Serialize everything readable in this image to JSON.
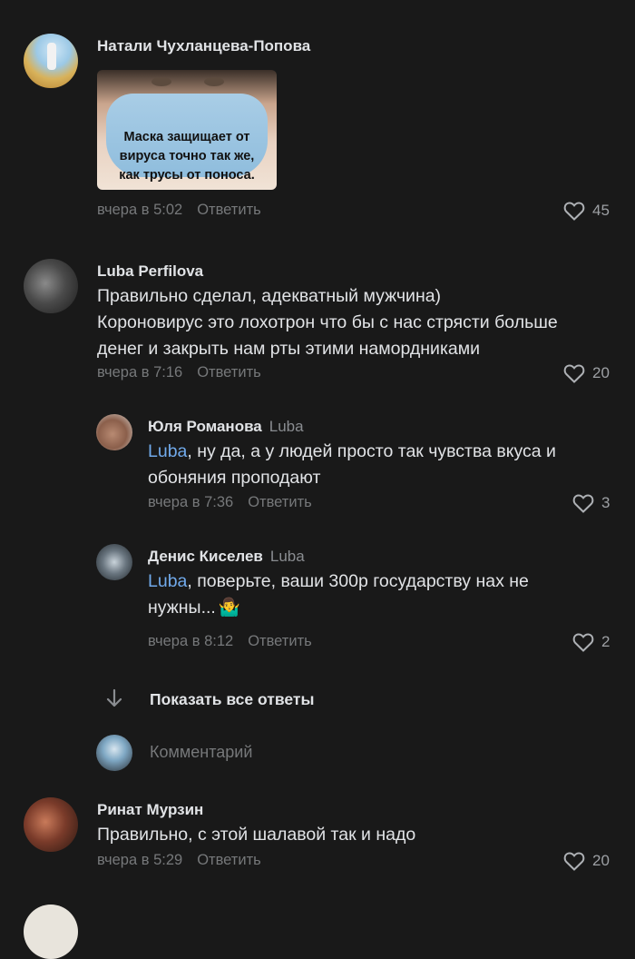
{
  "comments": [
    {
      "author": "Натали Чухланцева-Попова",
      "image_caption": [
        "Маска защищает от",
        "вируса точно так же,",
        "как трусы от поноса."
      ],
      "time": "вчера в 5:02",
      "reply_label": "Ответить",
      "likes": "45"
    },
    {
      "author": "Luba Perfilova",
      "text_lines": [
        "Правильно сделал, адекватный мужчина)",
        "Короновирус это лохотрон что бы с нас стрясти больше",
        "денег и закрыть нам рты этими намордниками"
      ],
      "time": "вчера в 7:16",
      "reply_label": "Ответить",
      "likes": "20",
      "replies": [
        {
          "author": "Юля Романова",
          "reply_to": "Luba",
          "mention": "Luba",
          "text_line1": ", ну да, а у людей просто так чувства вкуса и",
          "text_line2": "обоняния проподают",
          "time": "вчера в 7:36",
          "reply_label": "Ответить",
          "likes": "3"
        },
        {
          "author": "Денис Киселев",
          "reply_to": "Luba",
          "mention": "Luba",
          "text_line1": ", поверьте, ваши 300р государству нах не",
          "text_line2": "нужны...",
          "emoji": "🤷‍♂️",
          "time": "вчера в 8:12",
          "reply_label": "Ответить",
          "likes": "2"
        }
      ],
      "show_all_label": "Показать все ответы",
      "comment_placeholder": "Комментарий"
    },
    {
      "author": "Ринат Мурзин",
      "text_lines": [
        "Правильно, с этой шалавой так и надо"
      ],
      "time": "вчера в 5:29",
      "reply_label": "Ответить",
      "likes": "20"
    }
  ],
  "icons": {
    "like": "heart-outline-icon",
    "expand": "arrow-down-icon"
  },
  "colors": {
    "background": "#191919",
    "text": "#e1e3e6",
    "secondary": "#76787a",
    "link": "#71aaeb"
  }
}
